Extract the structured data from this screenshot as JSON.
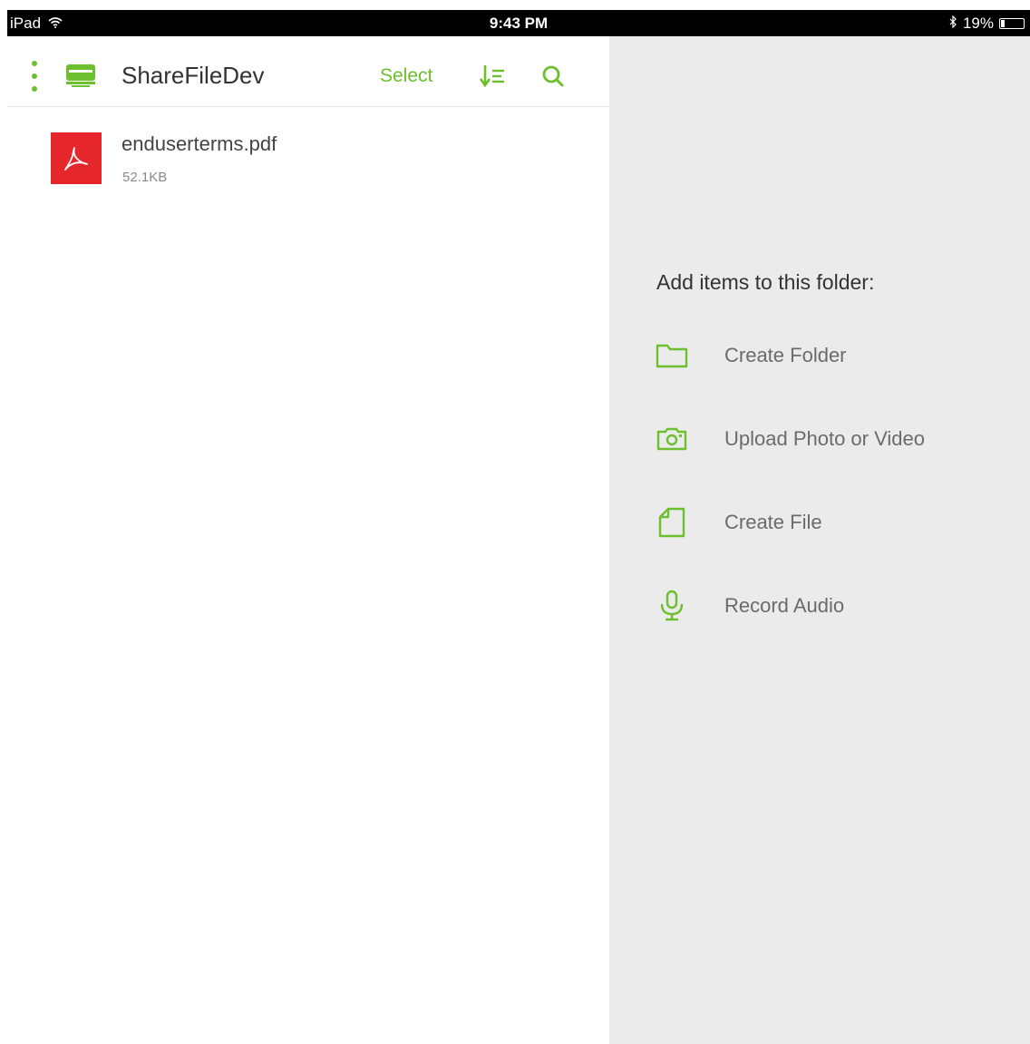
{
  "status_bar": {
    "device": "iPad",
    "time": "9:43 PM",
    "battery_percent": "19%",
    "battery_level": 0.19
  },
  "nav": {
    "title": "ShareFileDev",
    "select_label": "Select"
  },
  "files": [
    {
      "name": "enduserterms.pdf",
      "size": "52.1KB",
      "icon": "pdf-icon"
    }
  ],
  "add_panel": {
    "heading": "Add items to this folder:",
    "actions": [
      {
        "label": "Create Folder",
        "icon": "folder-icon"
      },
      {
        "label": "Upload Photo or Video",
        "icon": "camera-icon"
      },
      {
        "label": "Create File",
        "icon": "file-icon"
      },
      {
        "label": "Record Audio",
        "icon": "microphone-icon"
      }
    ]
  },
  "colors": {
    "accent": "#6cbf2d",
    "pdf_red": "#e5262b",
    "panel_bg": "#ebebeb",
    "status_bar_bg": "#000000"
  }
}
